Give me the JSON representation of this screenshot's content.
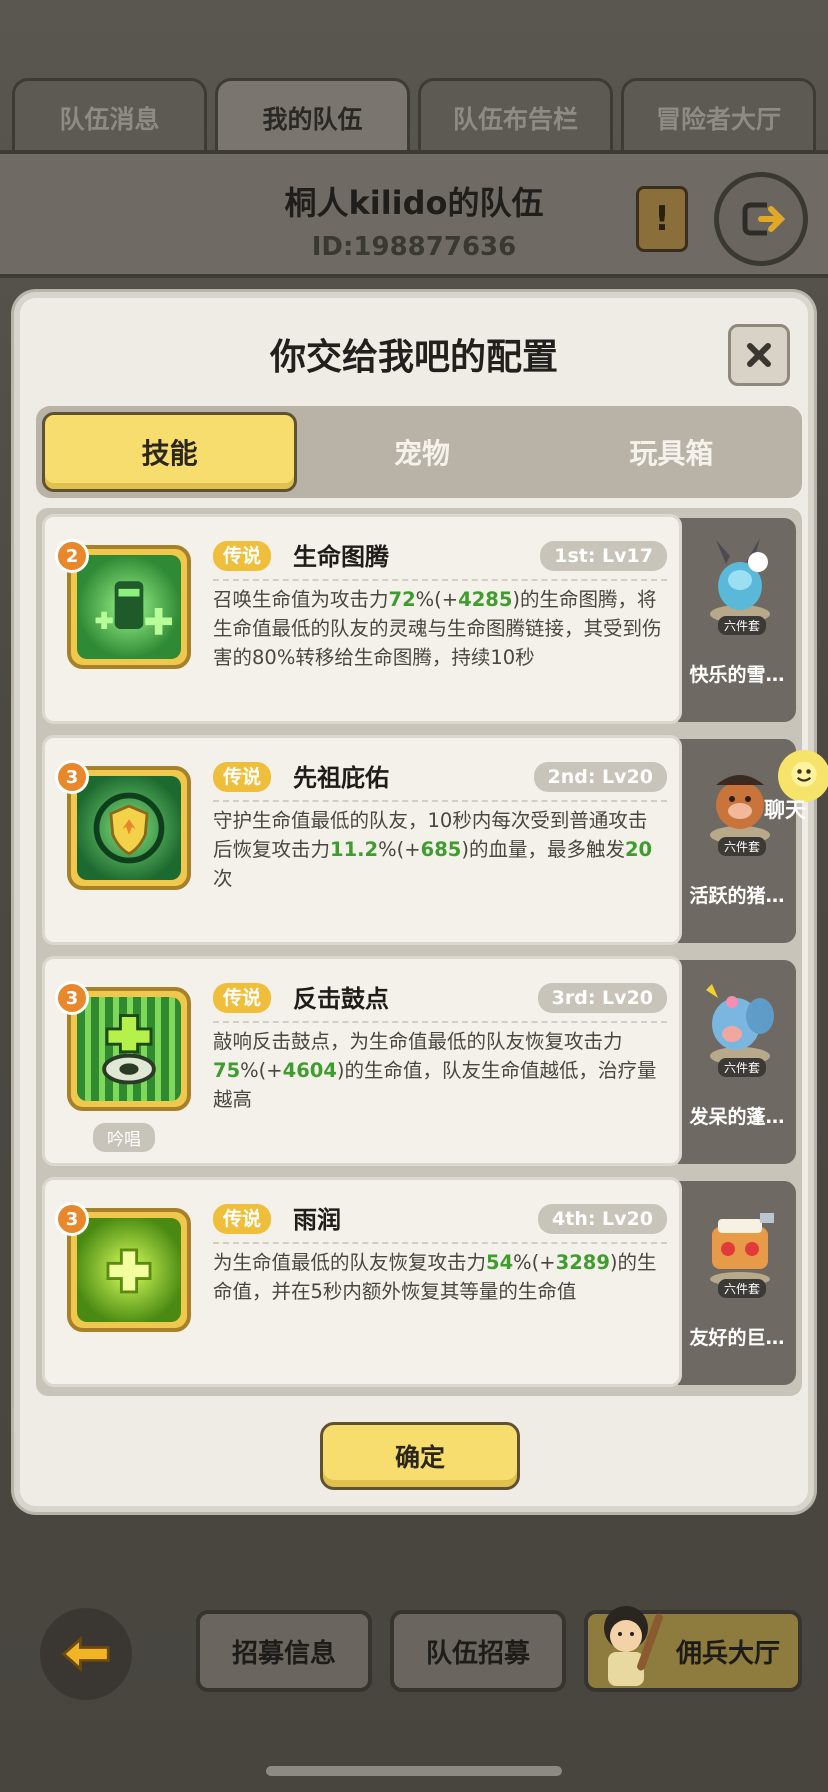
{
  "top_tabs": [
    {
      "label": "队伍消息"
    },
    {
      "label": "我的队伍"
    },
    {
      "label": "队伍布告栏"
    },
    {
      "label": "冒险者大厅"
    }
  ],
  "team": {
    "name": "桐人kilido的队伍",
    "id": "ID:198877636"
  },
  "modal": {
    "title": "你交给我吧的配置",
    "tabs": [
      {
        "label": "技能"
      },
      {
        "label": "宠物"
      },
      {
        "label": "玩具箱"
      }
    ],
    "skills": [
      {
        "level": "2",
        "rarity": "传说",
        "name": "生命图腾",
        "slot": "1st: Lv17",
        "desc_parts": [
          "召唤生命值为攻击力",
          "72",
          "%(+",
          "4285",
          ")的生命图腾，将生命值最低的队友的灵魂与生命图腾链接，其受到伤害的80%转移给生命图腾，持续10秒"
        ],
        "pet": {
          "name": "快乐的雪…",
          "badge": "六件套"
        }
      },
      {
        "level": "3",
        "rarity": "传说",
        "name": "先祖庇佑",
        "slot": "2nd: Lv20",
        "desc_parts": [
          "守护生命值最低的队友，10秒内每次受到普通攻击后恢复攻击力",
          "11.2",
          "%(+",
          "685",
          ")的血量，最多触发",
          "20",
          "次"
        ],
        "pet": {
          "name": "活跃的猪…",
          "badge": "六件套"
        }
      },
      {
        "level": "3",
        "rarity": "传说",
        "name": "反击鼓点",
        "slot": "3rd: Lv20",
        "chant": "吟唱",
        "desc_parts": [
          "敲响反击鼓点，为生命值最低的队友恢复攻击力",
          "75",
          "%(+",
          "4604",
          ")的生命值，队友生命值越低，治疗量越高"
        ],
        "pet": {
          "name": "发呆的蓬…",
          "badge": "六件套"
        }
      },
      {
        "level": "3",
        "rarity": "传说",
        "name": "雨润",
        "slot": "4th: Lv20",
        "desc_parts": [
          "为生命值最低的队友恢复攻击力",
          "54",
          "%(+",
          "3289",
          ")的生命值，并在5秒内额外恢复其等量的生命值"
        ],
        "pet": {
          "name": "友好的巨…",
          "badge": "六件套"
        }
      }
    ],
    "confirm_label": "确定",
    "chat_label": "聊天"
  },
  "bottom": {
    "recruit_info": "招募信息",
    "team_recruit": "队伍招募",
    "merc_hall": "佣兵大厅"
  },
  "colors": {
    "accent_yellow": "#f7dd6e",
    "highlight_green": "#3f9c2e",
    "rarity_gold": "#efbf3c"
  }
}
